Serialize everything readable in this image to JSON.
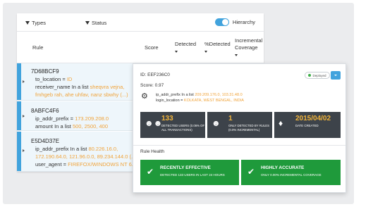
{
  "filters": {
    "types": "Types",
    "status": "Status",
    "hierarchy": "Hierarchy"
  },
  "columns": {
    "rule": "Rule",
    "score": "Score",
    "detected": "Detected",
    "pct_detected": "%Detected",
    "incremental": "Incremental",
    "coverage": "Coverage"
  },
  "rows": [
    {
      "id": "7D68BCF9",
      "l1_key": "to_location = ",
      "l1_val": "ID",
      "l2_key": "receiver_name In a list ",
      "l2_val": "sheqvra vejna,",
      "l3_val": "fmhgeb rah, ahe uhfav, nanz sbwhy (...)"
    },
    {
      "id": "8ABFC4F6",
      "l1_key": "ip_addr_prefix = ",
      "l1_val": "173.209.208.0",
      "l2_key": "amount In a list ",
      "l2_val": "500, 2500, 400"
    },
    {
      "id": "E5D4D37E",
      "l1_key": "ip_addr_prefix In a list ",
      "l1_val": "80.226.16.0,",
      "l2_val": "172.190.64.0, 121.96.0.0, 89.234.144.0 (...",
      "l3_key": "user_agent = ",
      "l3_val": "FIREFOX/WINDOWS NT 6.1"
    }
  ],
  "detail": {
    "id_label": "ID: EEF236C0",
    "score_label": "Score: 0.97",
    "status": "Deployed",
    "cond1_key": "ip_addr_prefix In a list ",
    "cond1_val": "209.209.176.0, 103.31.48.0",
    "cond2_key": "login_location = ",
    "cond2_val": "KOLKATA, WEST BENGAL, INDIA",
    "stats": [
      {
        "value": "133",
        "label": "DETECTED USERS (0.06% OF ALL TRANSACTIONS)",
        "icon": "users-icon"
      },
      {
        "value": "1",
        "label": "ONLY DETECTED BY RULES (0.0% INCREMENTAL)",
        "icon": "user-icon"
      },
      {
        "value": "2015/04/02",
        "label": "DATE CREATED",
        "icon": "tag-icon"
      }
    ],
    "health_title": "Rule Health",
    "health": [
      {
        "title": "RECENTLY EFFECTIVE",
        "text": "DETECTED 133 USERS IN LAST 24 HOURS"
      },
      {
        "title": "HIGHLY ACCURATE",
        "text": "ONLY 0.00% INCREMENTAL COVERAGE"
      }
    ]
  },
  "colors": {
    "accent": "#41a3dd",
    "orange": "#f0a33a",
    "stat_bg": "#3d434a",
    "stat_num": "#f2b53b",
    "health_green": "#1f9a3b"
  }
}
